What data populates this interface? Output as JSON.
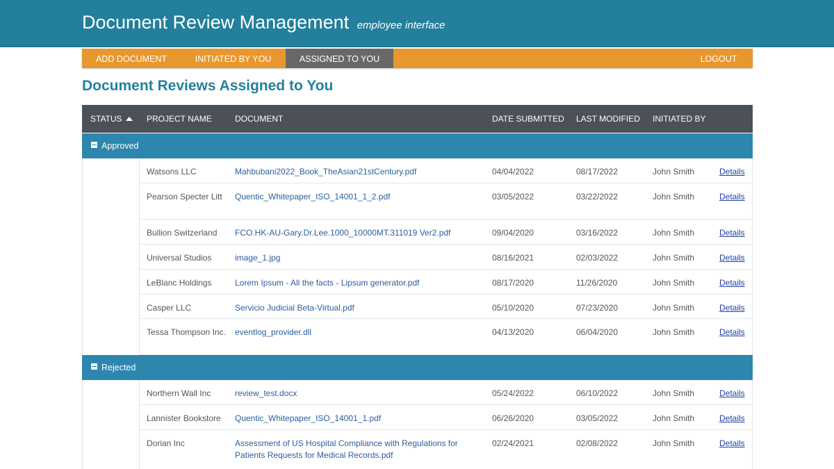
{
  "header": {
    "title": "Document Review Management",
    "subtitle": "employee interface"
  },
  "nav": {
    "add_document": "ADD DOCUMENT",
    "initiated_by_you": "INITIATED BY YOU",
    "assigned_to_you": "ASSIGNED TO YOU",
    "logout": "LOGOUT",
    "active": "ASSIGNED TO YOU"
  },
  "page": {
    "title": "Document Reviews Assigned to You"
  },
  "table": {
    "columns": [
      "STATUS",
      "PROJECT NAME",
      "DOCUMENT",
      "DATE SUBMITTED",
      "LAST MODIFIED",
      "INITIATED BY"
    ],
    "sort": {
      "column": "STATUS",
      "direction": "ascending",
      "icon": "sort-up-icon"
    },
    "groups": [
      {
        "label": "Approved",
        "rows": [
          {
            "project": "Watsons LLC",
            "document": "Mahbubani2022_Book_TheAsian21stCentury.pdf",
            "submitted": "04/04/2022",
            "modified": "08/17/2022",
            "initiated_by": "John Smith",
            "action": "Details"
          },
          {
            "project": "Pearson Specter Litt",
            "document": "Quentic_Whitepaper_ISO_14001_1_2.pdf",
            "submitted": "03/05/2022",
            "modified": "03/22/2022",
            "initiated_by": "John Smith",
            "action": "Details"
          },
          {
            "project": "Bullion Switzerland",
            "document": "FCO.HK-AU-Gary.Dr.Lee.1000_10000MT.311019 Ver2.pdf",
            "submitted": "09/04/2020",
            "modified": "03/16/2022",
            "initiated_by": "John Smith",
            "action": "Details"
          },
          {
            "project": "Universal Studios",
            "document": "image_1.jpg",
            "submitted": "08/16/2021",
            "modified": "02/03/2022",
            "initiated_by": "John Smith",
            "action": "Details"
          },
          {
            "project": "LeBlanc Holdings",
            "document": "Lorem Ipsum - All the facts - Lipsum generator.pdf",
            "submitted": "08/17/2020",
            "modified": "11/26/2020",
            "initiated_by": "John Smith",
            "action": "Details"
          },
          {
            "project": "Casper LLC",
            "document": "Servicio Judicial Beta-Virtual.pdf",
            "submitted": "05/10/2020",
            "modified": "07/23/2020",
            "initiated_by": "John Smith",
            "action": "Details"
          },
          {
            "project": "Tessa Thompson Inc.",
            "document": "eventlog_provider.dll",
            "submitted": "04/13/2020",
            "modified": "06/04/2020",
            "initiated_by": "John Smith",
            "action": "Details"
          }
        ]
      },
      {
        "label": "Rejected",
        "rows": [
          {
            "project": "Northern Wall Inc",
            "document": "review_test.docx",
            "submitted": "05/24/2022",
            "modified": "06/10/2022",
            "initiated_by": "John Smith",
            "action": "Details"
          },
          {
            "project": "Lannister Bookstore",
            "document": "Quentic_Whitepaper_ISO_14001_1.pdf",
            "submitted": "06/26/2020",
            "modified": "03/05/2022",
            "initiated_by": "John Smith",
            "action": "Details"
          },
          {
            "project": "Dorian Inc",
            "document": "Assessment of US Hospital Compliance with Regulations for Patients Requests for Medical Records.pdf",
            "submitted": "02/24/2021",
            "modified": "02/08/2022",
            "initiated_by": "John Smith",
            "action": "Details"
          }
        ]
      }
    ]
  },
  "colors": {
    "header_bg": "#237f9b",
    "nav_bg": "#e8972e",
    "nav_active_bg": "#686868",
    "table_header_bg": "#4b5157",
    "group_bg": "#2c86ae",
    "title_color": "#23819c",
    "link_color": "#2b5f9e"
  }
}
